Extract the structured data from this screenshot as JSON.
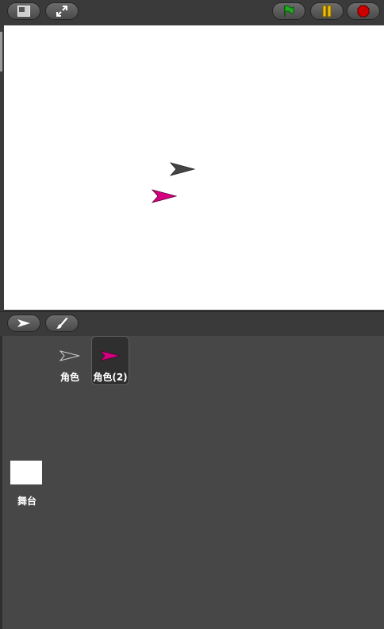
{
  "toolbar": {
    "buttons": [
      {
        "name": "small-stage-button",
        "icon": "small-stage-icon"
      },
      {
        "name": "fullscreen-button",
        "icon": "expand-arrows-icon"
      },
      {
        "name": "green-flag-button",
        "icon": "green-flag-icon"
      },
      {
        "name": "pause-button",
        "icon": "pause-icon"
      },
      {
        "name": "stop-button",
        "icon": "stop-icon"
      }
    ]
  },
  "colors": {
    "flag": "#22aa22",
    "pause": "#f2c100",
    "stop": "#cc0000",
    "sprite_gray": "#444444",
    "sprite_magenta": "#d4007f"
  },
  "tools": [
    {
      "name": "select-tool-button",
      "icon": "arrow-cursor-icon"
    },
    {
      "name": "paint-new-sprite-button",
      "icon": "paintbrush-icon"
    }
  ],
  "sprites": [
    {
      "label": "角色",
      "selected": false
    },
    {
      "label": "角色(2)",
      "selected": true
    }
  ],
  "stage": {
    "label": "舞台"
  }
}
